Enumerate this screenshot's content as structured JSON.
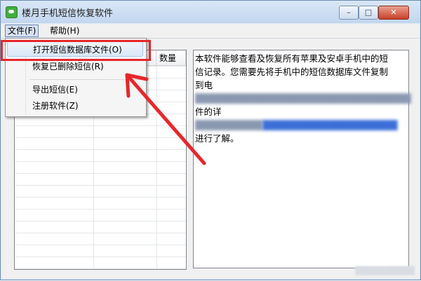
{
  "window": {
    "title": "楼月手机短信恢复软件",
    "controls": {
      "minimize": "–",
      "maximize": "□",
      "close": "✕"
    }
  },
  "menubar": {
    "file": "文件(F)",
    "help": "帮助(H)"
  },
  "file_menu": {
    "items": [
      {
        "label": "打开短信数据库文件(O)",
        "highlighted": true
      },
      {
        "label": "恢复已删除短信(R)"
      },
      {
        "label": "导出短信(E)"
      },
      {
        "label": "注册软件(Z)"
      }
    ]
  },
  "contact_list": {
    "columns": [
      "数量"
    ]
  },
  "description": {
    "line1": "本软件能够查看及恢复所有苹果及安卓手机中的短",
    "line2": "信记录。您需要先将手机中的短信数据库文件复制",
    "line3_visible": "到电",
    "line4_visible": "件的详",
    "line5": "进行了解。"
  },
  "annotation": {
    "highlight_color": "#e8262a"
  }
}
